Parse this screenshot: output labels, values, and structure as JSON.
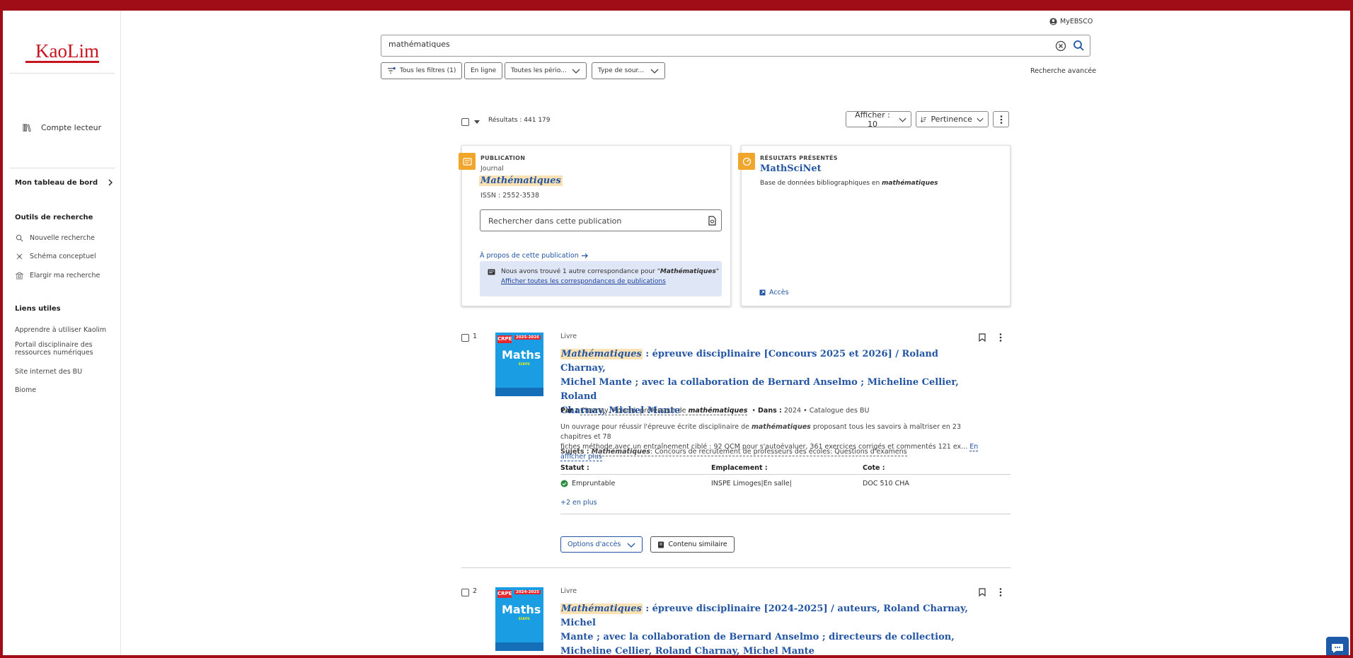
{
  "sidebar": {
    "logo": "KaoLim",
    "account": "Compte lecteur",
    "dashboard": "Mon tableau de bord",
    "tools_title": "Outils de recherche",
    "tools": [
      "Nouvelle recherche",
      "Schéma conceptuel",
      "Elargir ma recherche"
    ],
    "links_title": "Liens utiles",
    "links": [
      "Apprendre à utiliser Kaolim",
      "Portail disciplinaire des",
      "ressources numériques",
      "Site internet des BU",
      "Biome"
    ]
  },
  "header": {
    "myebsco": "MyEBSCO",
    "search_value": "mathématiques",
    "filters": [
      "Tous les filtres (1)",
      "En ligne",
      "Toutes les pério...",
      "Type de sour..."
    ],
    "advanced": "Recherche avancée"
  },
  "results_header": {
    "count": "Résultats : 441 179",
    "display": "Afficher : 10",
    "sort": "Pertinence"
  },
  "publication_card": {
    "overline": "PUBLICATION",
    "kind": "Journal",
    "title": "Mathématiques",
    "issn_label": "ISSN :",
    "issn": "2552-3538",
    "search_placeholder": "Rechercher dans cette publication",
    "about": "À propos de cette publication",
    "notice_pre": "Nous avons trouvé 1 autre correspondance pour \"",
    "notice_term": "Mathématiques",
    "notice_post": "\"",
    "notice_link": "Afficher toutes les correspondances de publications"
  },
  "featured_card": {
    "overline": "RÉSULTATS PRÉSENTÉS",
    "title": "MathSciNet",
    "desc_pre": "Base de données bibliographiques en ",
    "desc_term": "mathématiques",
    "access": "Accès"
  },
  "results": [
    {
      "num": "1",
      "type": "Livre",
      "cover": {
        "badge": "CRPE",
        "year": "2025-2026",
        "title": "Maths",
        "sub": "ÉCRITE"
      },
      "title_hl": "Mathématiques",
      "title_line1": " : épreuve disciplinaire [Concours 2025 et 2026] / Roland Charnay,",
      "title_line2": "Michel Mante ; avec la collaboration de Bernard Anselmo ; Micheline Cellier, Roland",
      "title_line3": "Charnay, Michel Mante",
      "by_label": "Par :",
      "by_value": "Charnay, Roland, professeur de ",
      "by_term": "mathématiques",
      "in_label": "Dans :",
      "in_value": "2024 • Catalogue des BU",
      "desc1_pre": "Un ouvrage pour réussir l'épreuve écrite disciplinaire de ",
      "desc1_term": "mathématiques",
      "desc1_post": " proposant tous les savoirs à maîtriser en 23 chapitres et 78",
      "desc2": "fiches méthode avec un entraînement ciblé : 92 QCM pour s'autoévaluer, 361 exercices corrigés et commentés 121 ex...",
      "more": "En afficher plus",
      "subjects_label": "Sujets :",
      "subject_term": "Mathématiques",
      "subject_rest": ": Concours de recrutement de professeurs des écoles: Questions d'examens",
      "status_h": "Statut :",
      "location_h": "Emplacement :",
      "cote_h": "Cote :",
      "status": "Empruntable",
      "location": "INSPE Limoges|En salle|",
      "cote": "DOC 510 CHA",
      "plus_more": "+2 en plus",
      "access_btn": "Options d'accès",
      "similar_btn": "Contenu similaire"
    },
    {
      "num": "2",
      "type": "Livre",
      "cover": {
        "badge": "CRPE",
        "year": "2024-2025",
        "title": "Maths",
        "sub": "ÉCRITE"
      },
      "title_hl": "Mathématiques",
      "title_line1": " : épreuve disciplinaire [2024-2025] / auteurs, Roland Charnay, Michel",
      "title_line2": "Mante ; avec la collaboration de Bernard Anselmo ; directeurs de collection,",
      "title_line3": "Micheline Cellier, Roland Charnay, Michel Mante"
    }
  ],
  "colors": {
    "brand": "#c8141f",
    "link": "#2355a3",
    "highlight": "#fbe2b5",
    "badge": "#f0a52b",
    "frame": "#a00d17"
  }
}
